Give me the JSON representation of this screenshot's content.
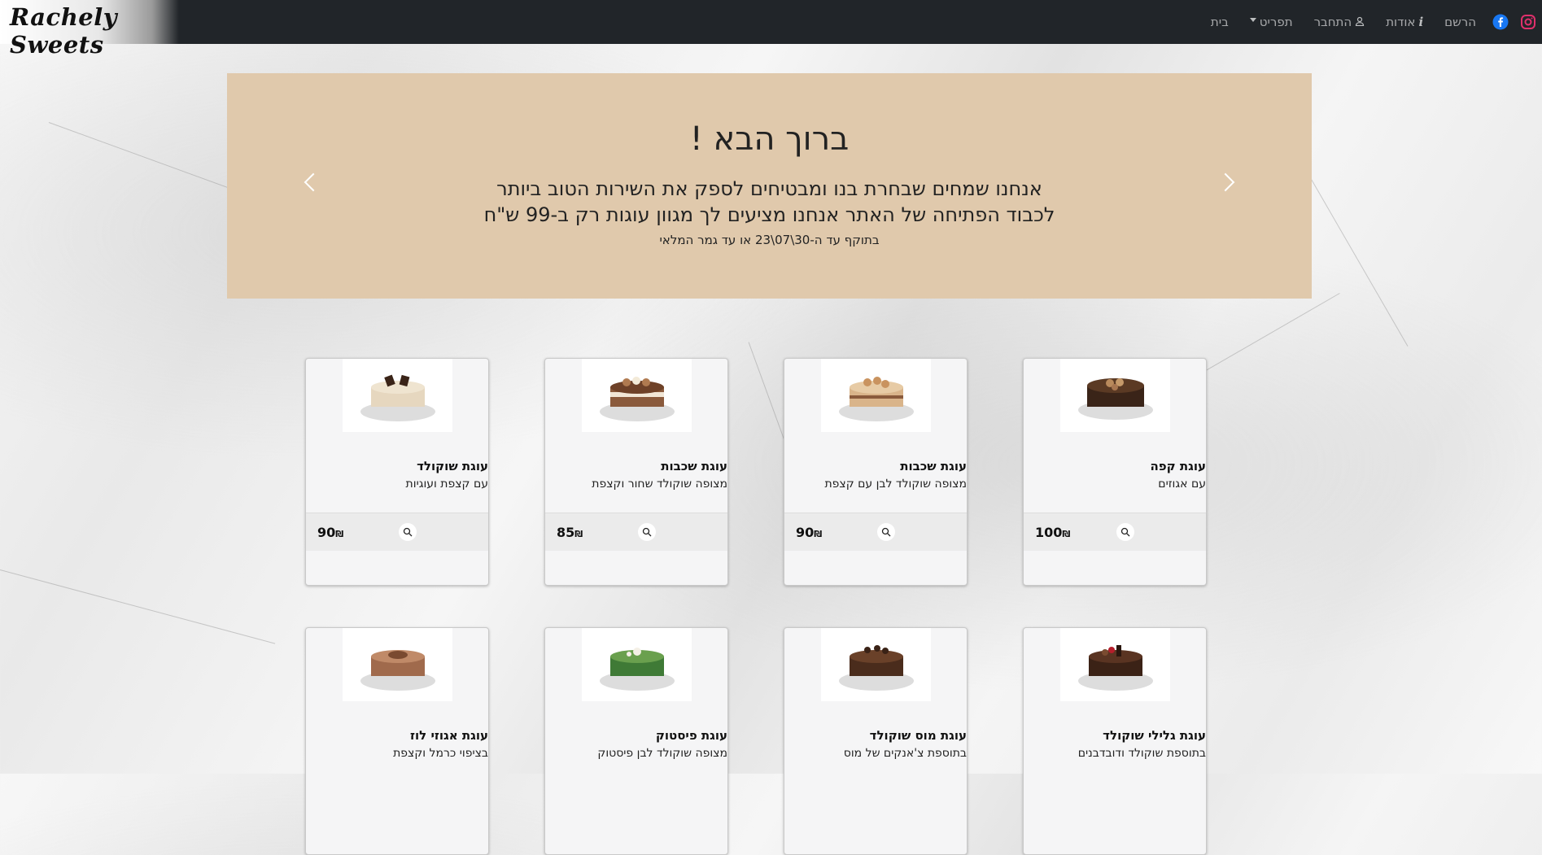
{
  "brand": {
    "name": "Rachely Sweets"
  },
  "nav": {
    "items": [
      {
        "label": "בית",
        "icon": null
      },
      {
        "label": "תפריט",
        "icon": "caret-down-icon"
      },
      {
        "label": "התחבר",
        "icon": "user-icon"
      },
      {
        "label": "אודות",
        "icon": "info-icon"
      },
      {
        "label": "הרשם",
        "icon": null
      }
    ],
    "social": [
      "facebook-icon",
      "instagram-icon"
    ]
  },
  "hero": {
    "title": "ברוך הבא !",
    "line1": "אנחנו שמחים שבחרת בנו ומבטיחים לספק את השירות הטוב ביותר",
    "line2": "לכבוד הפתיחה של האתר אנחנו מציעים לך מגוון עוגות רק ב-99 ש\"ח",
    "line3": "בתוקף עד ה-30\\07\\23 או עד גמר המלאי"
  },
  "products": [
    {
      "title": "עוגת קפה",
      "desc": "עם אגוזים",
      "price": "100",
      "currency": "₪",
      "color": "#3a2418"
    },
    {
      "title": "עוגת שכבות",
      "desc": "מצופה שוקולד לבן עם קצפת",
      "price": "90",
      "currency": "₪",
      "color": "#d9b48a"
    },
    {
      "title": "עוגת שכבות",
      "desc": "מצופה שוקולד שחור וקצפת",
      "price": "85",
      "currency": "₪",
      "color": "#8a5a3c"
    },
    {
      "title": "עוגת שוקולד",
      "desc": "עם קצפת ועוגיות",
      "price": "90",
      "currency": "₪",
      "color": "#e6d7bf"
    },
    {
      "title": "עוגת גלילי שוקולד",
      "desc": "בתוספת שוקולד ודובדבנים",
      "price": "",
      "currency": "",
      "color": "#3b2216"
    },
    {
      "title": "עוגת מוס שוקולד",
      "desc": "בתוספת צ'אנקים של מוס",
      "price": "",
      "currency": "",
      "color": "#4a2c1c"
    },
    {
      "title": "עוגת פיסטוק",
      "desc": "מצופה שוקולד לבן פיסטוק",
      "price": "",
      "currency": "",
      "color": "#3f7a36"
    },
    {
      "title": "עוגת אגוזי לוז",
      "desc": "בציפוי כרמל וקצפת",
      "price": "",
      "currency": "",
      "color": "#a06a4c"
    }
  ]
}
